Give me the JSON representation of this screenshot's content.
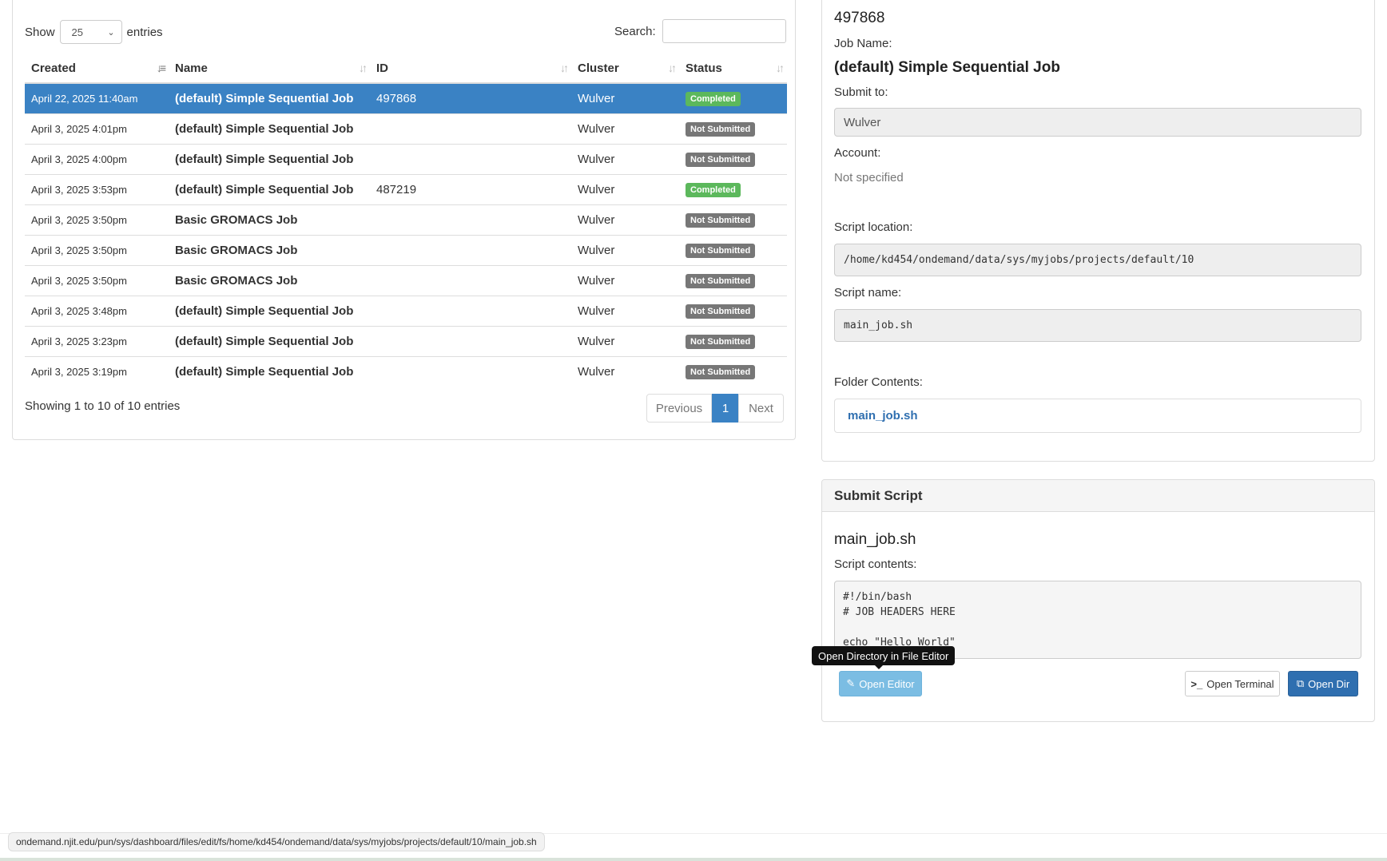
{
  "table_controls": {
    "show_label": "Show",
    "entries_value": "25",
    "entries_label": "entries",
    "search_label": "Search:",
    "search_value": ""
  },
  "table": {
    "columns": [
      "Created",
      "Name",
      "ID",
      "Cluster",
      "Status"
    ],
    "rows": [
      {
        "created": "April 22, 2025 11:40am",
        "name": "(default) Simple Sequential Job",
        "id": "497868",
        "cluster": "Wulver",
        "status": "Completed"
      },
      {
        "created": "April 3, 2025 4:01pm",
        "name": "(default) Simple Sequential Job",
        "id": "",
        "cluster": "Wulver",
        "status": "Not Submitted"
      },
      {
        "created": "April 3, 2025 4:00pm",
        "name": "(default) Simple Sequential Job",
        "id": "",
        "cluster": "Wulver",
        "status": "Not Submitted"
      },
      {
        "created": "April 3, 2025 3:53pm",
        "name": "(default) Simple Sequential Job",
        "id": "487219",
        "cluster": "Wulver",
        "status": "Completed"
      },
      {
        "created": "April 3, 2025 3:50pm",
        "name": "Basic GROMACS Job",
        "id": "",
        "cluster": "Wulver",
        "status": "Not Submitted"
      },
      {
        "created": "April 3, 2025 3:50pm",
        "name": "Basic GROMACS Job",
        "id": "",
        "cluster": "Wulver",
        "status": "Not Submitted"
      },
      {
        "created": "April 3, 2025 3:50pm",
        "name": "Basic GROMACS Job",
        "id": "",
        "cluster": "Wulver",
        "status": "Not Submitted"
      },
      {
        "created": "April 3, 2025 3:48pm",
        "name": "(default) Simple Sequential Job",
        "id": "",
        "cluster": "Wulver",
        "status": "Not Submitted"
      },
      {
        "created": "April 3, 2025 3:23pm",
        "name": "(default) Simple Sequential Job",
        "id": "",
        "cluster": "Wulver",
        "status": "Not Submitted"
      },
      {
        "created": "April 3, 2025 3:19pm",
        "name": "(default) Simple Sequential Job",
        "id": "",
        "cluster": "Wulver",
        "status": "Not Submitted"
      }
    ],
    "selected_row": 0,
    "info": "Showing 1 to 10 of 10 entries",
    "pagination": {
      "previous": "Previous",
      "current": "1",
      "next": "Next"
    }
  },
  "details": {
    "job_id": "497868",
    "job_name_label": "Job Name:",
    "job_name": "(default) Simple Sequential Job",
    "submit_to_label": "Submit to:",
    "submit_to": "Wulver",
    "account_label": "Account:",
    "account": "Not specified",
    "script_location_label": "Script location:",
    "script_location": "/home/kd454/ondemand/data/sys/myjobs/projects/default/10",
    "script_name_label": "Script name:",
    "script_name": "main_job.sh",
    "folder_contents_label": "Folder Contents:",
    "folder_file": "main_job.sh"
  },
  "submit_script": {
    "heading": "Submit Script",
    "file_name": "main_job.sh",
    "contents_label": "Script contents:",
    "contents": "#!/bin/bash\n# JOB HEADERS HERE\n\necho \"Hello World\"",
    "open_editor": "Open Editor",
    "open_terminal": "Open Terminal",
    "open_dir": "Open Dir",
    "tooltip": "Open Directory in File Editor"
  },
  "status_url": "ondemand.njit.edu/pun/sys/dashboard/files/edit/fs/home/kd454/ondemand/data/sys/myjobs/projects/default/10/main_job.sh",
  "colors": {
    "selected_row": "#3a82c4",
    "completed": "#5cb85c",
    "not_submitted": "#777777",
    "primary": "#2f6fb0"
  }
}
